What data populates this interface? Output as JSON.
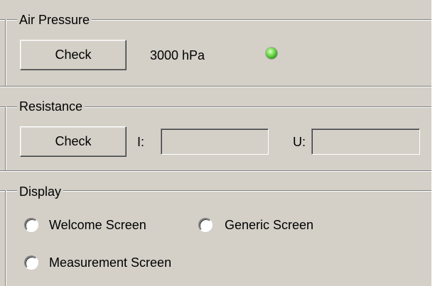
{
  "air_pressure": {
    "legend": "Air Pressure",
    "check_label": "Check",
    "value": "3000 hPa",
    "status_color": "#5fd13f"
  },
  "resistance": {
    "legend": "Resistance",
    "check_label": "Check",
    "i_label": "I:",
    "i_value": "",
    "u_label": "U:",
    "u_value": ""
  },
  "display": {
    "legend": "Display",
    "options": [
      {
        "label": "Welcome Screen",
        "selected": false
      },
      {
        "label": "Generic Screen",
        "selected": false
      },
      {
        "label": "Measurement Screen",
        "selected": false
      }
    ]
  }
}
